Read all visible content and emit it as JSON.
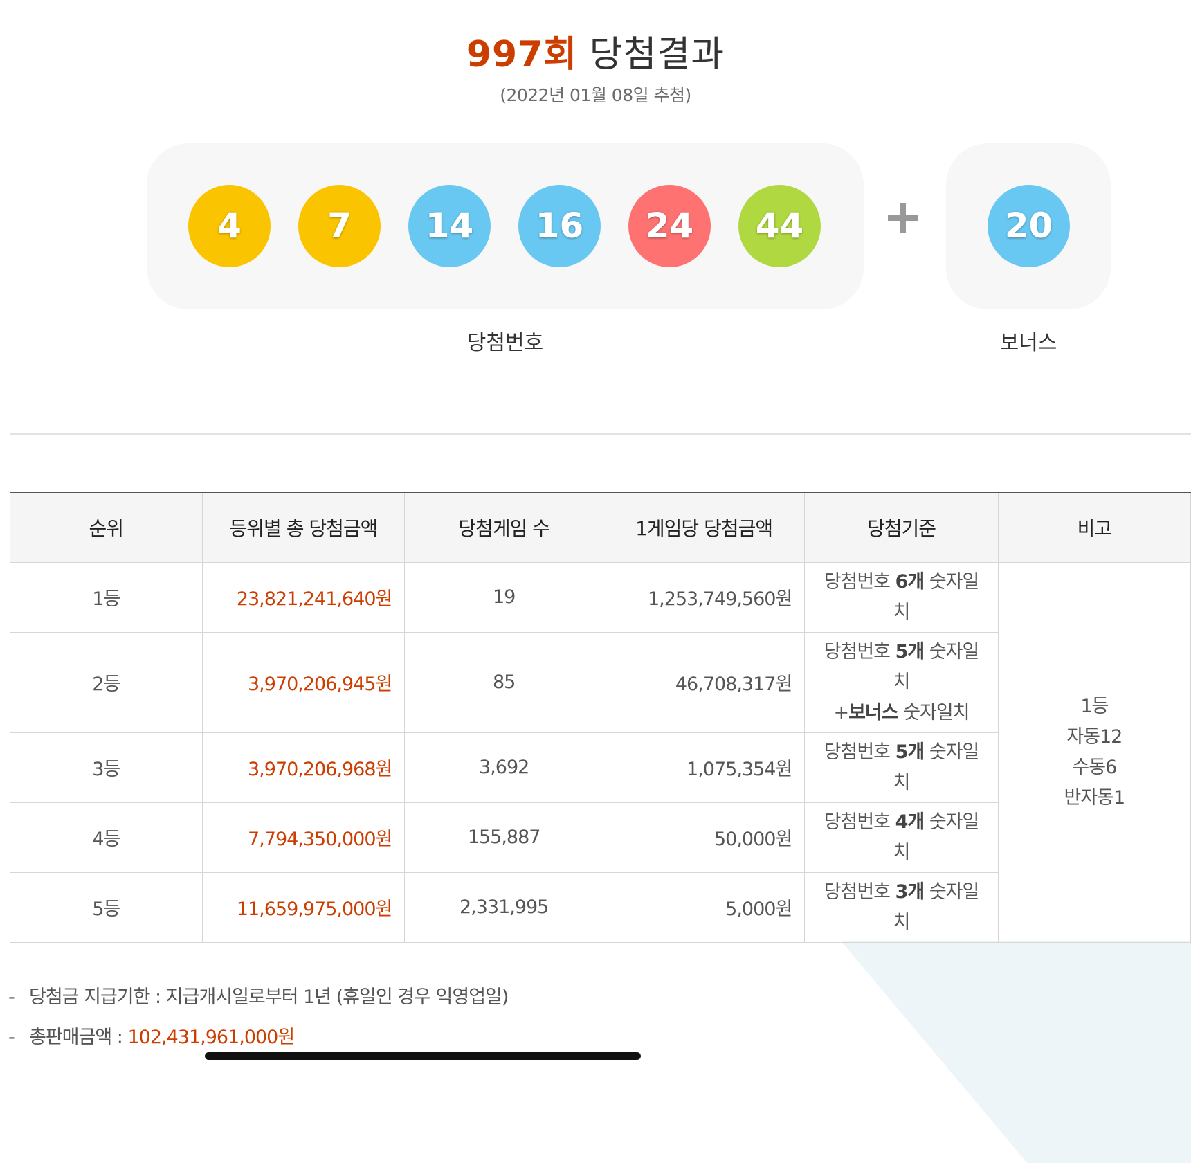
{
  "header": {
    "round": "997회",
    "title_suffix": "당첨결과",
    "draw_date": "(2022년 01월 08일 추첨)"
  },
  "numbers": {
    "winning": [
      {
        "value": "4",
        "color": "#fbc400"
      },
      {
        "value": "7",
        "color": "#fbc400"
      },
      {
        "value": "14",
        "color": "#69c8f2"
      },
      {
        "value": "16",
        "color": "#69c8f2"
      },
      {
        "value": "24",
        "color": "#ff7272"
      },
      {
        "value": "44",
        "color": "#b0d840"
      }
    ],
    "bonus": {
      "value": "20",
      "color": "#69c8f2"
    },
    "winning_label": "당첨번호",
    "bonus_label": "보너스"
  },
  "table": {
    "headers": [
      "순위",
      "등위별 총 당첨금액",
      "당첨게임 수",
      "1게임당 당첨금액",
      "당첨기준",
      "비고"
    ],
    "rows": [
      {
        "rank": "1등",
        "total": "23,821,241,640원",
        "count": "19",
        "per_game": "1,253,749,560원",
        "crit_pre": "당첨번호 ",
        "crit_bold": "6개",
        "crit_post": " 숫자일치"
      },
      {
        "rank": "2등",
        "total": "3,970,206,945원",
        "count": "85",
        "per_game": "46,708,317원",
        "crit_pre": "당첨번호 ",
        "crit_bold": "5개",
        "crit_post": " 숫자일치",
        "crit2_pre": "+",
        "crit2_bold": "보너스",
        "crit2_post": " 숫자일치"
      },
      {
        "rank": "3등",
        "total": "3,970,206,968원",
        "count": "3,692",
        "per_game": "1,075,354원",
        "crit_pre": "당첨번호 ",
        "crit_bold": "5개",
        "crit_post": " 숫자일치"
      },
      {
        "rank": "4등",
        "total": "7,794,350,000원",
        "count": "155,887",
        "per_game": "50,000원",
        "crit_pre": "당첨번호 ",
        "crit_bold": "4개",
        "crit_post": " 숫자일치"
      },
      {
        "rank": "5등",
        "total": "11,659,975,000원",
        "count": "2,331,995",
        "per_game": "5,000원",
        "crit_pre": "당첨번호 ",
        "crit_bold": "3개",
        "crit_post": " 숫자일치"
      }
    ],
    "note": [
      "1등",
      "자동12",
      "수동6",
      "반자동1"
    ]
  },
  "footer": {
    "dash": "-",
    "deadline_label": "당첨금 지급기한 : 지급개시일로부터 1년 (휴일인 경우 익영업일)",
    "sales_label": "총판매금액 : ",
    "sales_value": "102,431,961,000원"
  },
  "colors": {
    "accent": "#cc3d00"
  }
}
